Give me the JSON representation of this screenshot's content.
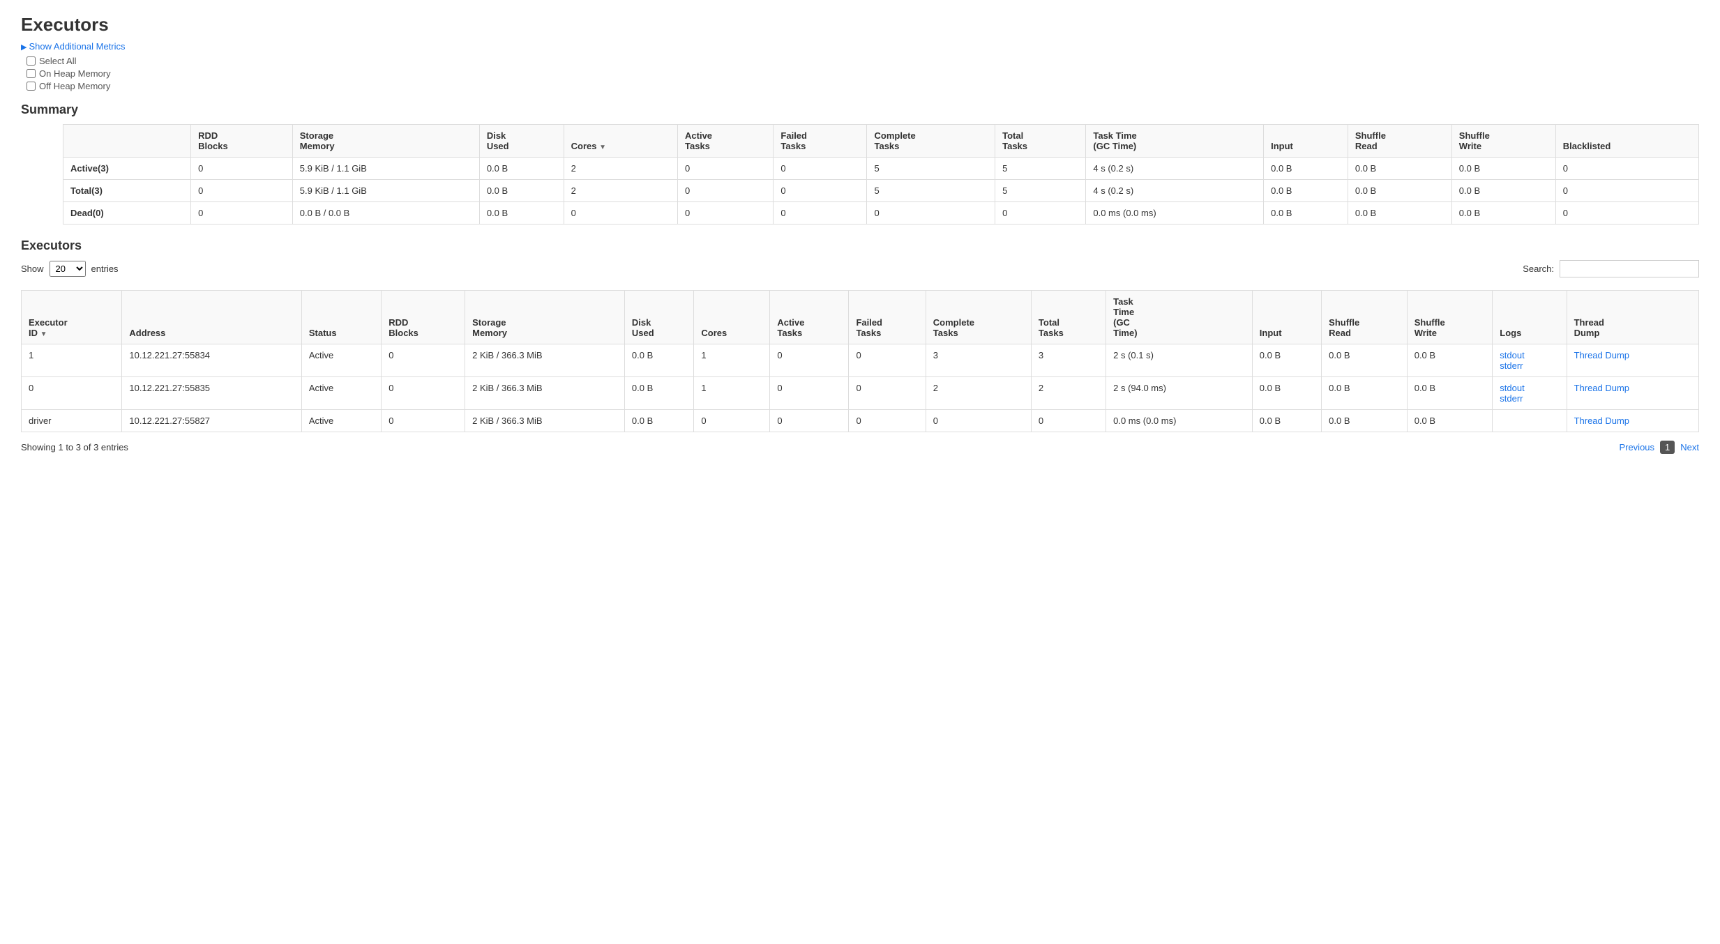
{
  "page": {
    "title": "Executors"
  },
  "metrics_link": {
    "label": "Show Additional Metrics"
  },
  "checkboxes": [
    {
      "id": "select-all",
      "label": "Select All",
      "checked": false
    },
    {
      "id": "on-heap",
      "label": "On Heap Memory",
      "checked": false
    },
    {
      "id": "off-heap",
      "label": "Off Heap Memory",
      "checked": false
    }
  ],
  "summary": {
    "title": "Summary",
    "columns": [
      "",
      "RDD Blocks",
      "Storage Memory",
      "Disk Used",
      "Cores",
      "Active Tasks",
      "Failed Tasks",
      "Complete Tasks",
      "Total Tasks",
      "Task Time (GC Time)",
      "Input",
      "Shuffle Read",
      "Shuffle Write",
      "Blacklisted"
    ],
    "rows": [
      {
        "label": "Active(3)",
        "rdd_blocks": "0",
        "storage_memory": "5.9 KiB / 1.1 GiB",
        "disk_used": "0.0 B",
        "cores": "2",
        "active_tasks": "0",
        "failed_tasks": "0",
        "complete_tasks": "5",
        "total_tasks": "5",
        "task_time": "4 s (0.2 s)",
        "input": "0.0 B",
        "shuffle_read": "0.0 B",
        "shuffle_write": "0.0 B",
        "blacklisted": "0"
      },
      {
        "label": "Total(3)",
        "rdd_blocks": "0",
        "storage_memory": "5.9 KiB / 1.1 GiB",
        "disk_used": "0.0 B",
        "cores": "2",
        "active_tasks": "0",
        "failed_tasks": "0",
        "complete_tasks": "5",
        "total_tasks": "5",
        "task_time": "4 s (0.2 s)",
        "input": "0.0 B",
        "shuffle_read": "0.0 B",
        "shuffle_write": "0.0 B",
        "blacklisted": "0"
      },
      {
        "label": "Dead(0)",
        "rdd_blocks": "0",
        "storage_memory": "0.0 B / 0.0 B",
        "disk_used": "0.0 B",
        "cores": "0",
        "active_tasks": "0",
        "failed_tasks": "0",
        "complete_tasks": "0",
        "total_tasks": "0",
        "task_time": "0.0 ms (0.0 ms)",
        "input": "0.0 B",
        "shuffle_read": "0.0 B",
        "shuffle_write": "0.0 B",
        "blacklisted": "0"
      }
    ]
  },
  "executors": {
    "title": "Executors",
    "show_label": "Show",
    "show_value": "20",
    "entries_label": "entries",
    "search_label": "Search:",
    "search_placeholder": "",
    "columns": [
      "Executor ID",
      "Address",
      "Status",
      "RDD Blocks",
      "Storage Memory",
      "Disk Used",
      "Cores",
      "Active Tasks",
      "Failed Tasks",
      "Complete Tasks",
      "Total Tasks",
      "Task Time (GC Time)",
      "Input",
      "Shuffle Read",
      "Shuffle Write",
      "Logs",
      "Thread Dump"
    ],
    "rows": [
      {
        "executor_id": "1",
        "address": "10.12.221.27:55834",
        "status": "Active",
        "rdd_blocks": "0",
        "storage_memory": "2 KiB / 366.3 MiB",
        "disk_used": "0.0 B",
        "cores": "1",
        "active_tasks": "0",
        "failed_tasks": "0",
        "complete_tasks": "3",
        "total_tasks": "3",
        "task_time": "2 s (0.1 s)",
        "input": "0.0 B",
        "shuffle_read": "0.0 B",
        "shuffle_write": "0.0 B",
        "logs_stdout": "stdout",
        "logs_stderr": "stderr",
        "thread_dump": "Thread Dump"
      },
      {
        "executor_id": "0",
        "address": "10.12.221.27:55835",
        "status": "Active",
        "rdd_blocks": "0",
        "storage_memory": "2 KiB / 366.3 MiB",
        "disk_used": "0.0 B",
        "cores": "1",
        "active_tasks": "0",
        "failed_tasks": "0",
        "complete_tasks": "2",
        "total_tasks": "2",
        "task_time": "2 s (94.0 ms)",
        "input": "0.0 B",
        "shuffle_read": "0.0 B",
        "shuffle_write": "0.0 B",
        "logs_stdout": "stdout",
        "logs_stderr": "stderr",
        "thread_dump": "Thread Dump"
      },
      {
        "executor_id": "driver",
        "address": "10.12.221.27:55827",
        "status": "Active",
        "rdd_blocks": "0",
        "storage_memory": "2 KiB / 366.3 MiB",
        "disk_used": "0.0 B",
        "cores": "0",
        "active_tasks": "0",
        "failed_tasks": "0",
        "complete_tasks": "0",
        "total_tasks": "0",
        "task_time": "0.0 ms (0.0 ms)",
        "input": "0.0 B",
        "shuffle_read": "0.0 B",
        "shuffle_write": "0.0 B",
        "logs_stdout": "",
        "logs_stderr": "",
        "thread_dump": "Thread Dump"
      }
    ],
    "footer": {
      "showing": "Showing 1 to 3 of 3 entries",
      "previous": "Previous",
      "page": "1",
      "next": "Next"
    }
  }
}
